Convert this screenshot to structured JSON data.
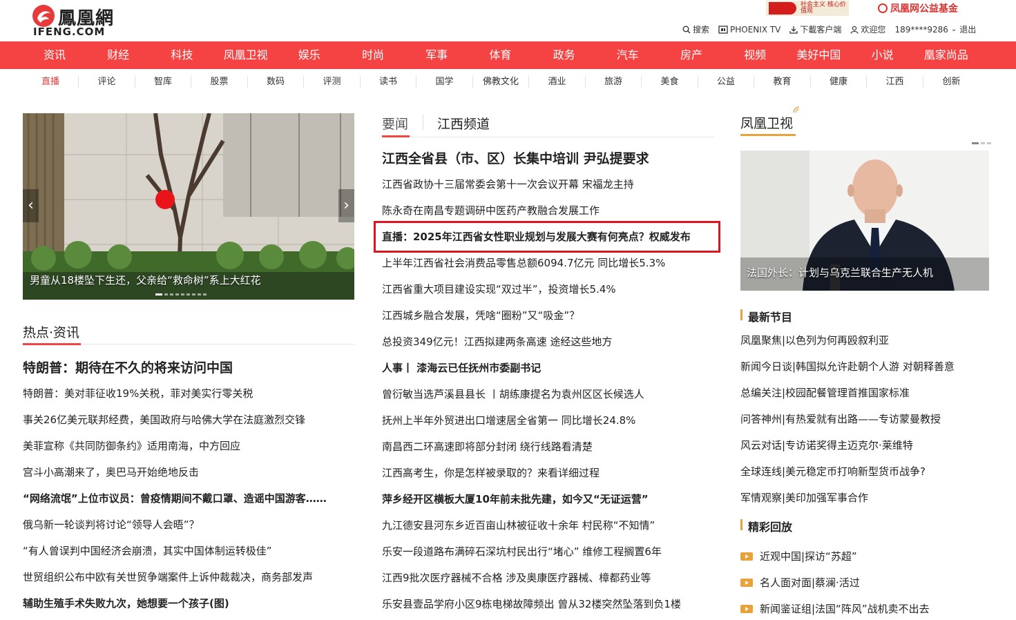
{
  "header": {
    "logo_cn": "鳳凰網",
    "logo_en": "IFENG.COM",
    "promo1_text": "社会主义 核心价值观",
    "promo2_text": "凤凰网公益基金",
    "top_links": {
      "search": "搜索",
      "phoenix_tv": "PHOENIX TV",
      "download": "下載客户端",
      "welcome": "欢迎您",
      "user": "189****9286",
      "logout": "退出"
    }
  },
  "main_nav": [
    "资讯",
    "财经",
    "科技",
    "凤凰卫视",
    "娱乐",
    "时尚",
    "军事",
    "体育",
    "政务",
    "汽车",
    "房产",
    "视频",
    "美好中国",
    "小说",
    "凰家尚品"
  ],
  "sub_nav": {
    "items": [
      "直播",
      "评论",
      "智库",
      "股票",
      "数码",
      "评测",
      "读书",
      "国学",
      "佛教文化",
      "酒业",
      "旅游",
      "美食",
      "公益",
      "教育",
      "健康",
      "江西",
      "创新"
    ],
    "active_index": 0
  },
  "carousel": {
    "caption": "男童从18楼坠下生还，父亲给“救命树”系上大红花",
    "prev": "‹",
    "next": "›",
    "slide_count": 9,
    "active_slide": 0
  },
  "hot": {
    "title": "热点·资讯",
    "lead": "特朗普：期待在不久的将来访问中国",
    "items": [
      {
        "text": "特朗普：美对菲征收19%关税，菲对美实行零关税",
        "bold": false
      },
      {
        "text": "事关26亿美元联邦经费，美国政府与哈佛大学在法庭激烈交锋",
        "bold": false
      },
      {
        "text": "美菲宣称《共同防御条约》适用南海，中方回应",
        "bold": false
      },
      {
        "text": "宫斗小高潮来了，奥巴马开始绝地反击",
        "bold": false
      },
      {
        "text": "“网络流氓”上位市议员：曾疫情期间不戴口罩、造谣中国游客……",
        "bold": true
      },
      {
        "text": "俄乌新一轮谈判将讨论“领导人会晤”？",
        "bold": false
      },
      {
        "text": "“有人曾误判中国经济会崩溃，其实中国体制运转极佳”",
        "bold": false
      },
      {
        "text": "世贸组织公布中欧有关世贸争端案件上诉仲裁裁决，商务部发声",
        "bold": false
      },
      {
        "text": "辅助生殖手术失败九次，她想要一个孩子(图)",
        "bold": true
      }
    ]
  },
  "news": {
    "tab_active": "要闻",
    "tab_other": "江西频道",
    "lead": "江西全省县（市、区）长集中培训 尹弘提要求",
    "items": [
      {
        "text": "江西省政协十三届常委会第十一次会议开幕 宋福龙主持",
        "bold": false
      },
      {
        "text": "陈永奇在南昌专题调研中医药产教融合发展工作",
        "bold": false
      },
      {
        "text": "直播：2025年江西省女性职业规划与发展大赛有何亮点？权威发布",
        "bold": true
      },
      {
        "text": "上半年江西省社会消费品零售总额6094.7亿元 同比增长5.3%",
        "bold": false
      },
      {
        "text": "江西省重大项目建设实现“双过半”，投资增长5.4%",
        "bold": false
      },
      {
        "text": "江西城乡融合发展，凭啥“圈粉”又“吸金”？",
        "bold": false
      },
      {
        "text": "总投资349亿元！江西拟建两条高速 途经这些地方",
        "bold": false
      },
      {
        "text": "人事丨 漆海云已任抚州市委副书记",
        "bold": true
      },
      {
        "text": "曾衍敏当选芦溪县县长 丨胡练康提名为袁州区区长候选人",
        "bold": false
      },
      {
        "text": "抚州上半年外贸进出口增速居全省第一 同比增长24.8%",
        "bold": false
      },
      {
        "text": "南昌西二环高速即将部分封闭 绕行线路看清楚",
        "bold": false
      },
      {
        "text": "江西高考生，你是怎样被录取的？来看详细过程",
        "bold": false
      },
      {
        "text": "萍乡经开区横板大厦10年前未批先建，如今又“无证运营”",
        "bold": true
      },
      {
        "text": "九江德安县河东乡近百亩山林被征收十余年 村民称“不知情”",
        "bold": false
      },
      {
        "text": "乐安一段道路布满碎石深坑村民出行“堵心” 维修工程搁置6年",
        "bold": false
      },
      {
        "text": "江西9批次医疗器械不合格 涉及奥康医疗器械、樟都药业等",
        "bold": false
      },
      {
        "text": "乐安县壹品学府小区9栋电梯故障频出 曾从32楼突然坠落到负1楼",
        "bold": false
      }
    ]
  },
  "tv": {
    "title": "凤凰卫视",
    "caption": "法国外长：计划与乌克兰联合生产无人机",
    "latest_title": "最新节目",
    "latest": [
      "凤凰聚焦|以色列为何再殴叙利亚",
      "新闻今日谈|韩国拟允许赴朝个人游 对朝释善意",
      "总编关注|校园配餐管理首推国家标准",
      "问答神州|有热爱就有出路——专访蒙曼教授",
      "风云对话|专访诺奖得主迈克尔·莱维特",
      "全球连线|美元稳定币打响新型货币战争?",
      "军情观察|美印加强军事合作"
    ],
    "replay_title": "精彩回放",
    "replay": [
      "近观中国|探访“苏超”",
      "名人面对面|蔡澜·活过",
      "新闻鉴证组|法国“阵风”战机卖不出去"
    ]
  },
  "colors": {
    "brand_red": "#f54343",
    "highlight_border": "#e0141f",
    "accent_gold": "#e8a23a"
  }
}
